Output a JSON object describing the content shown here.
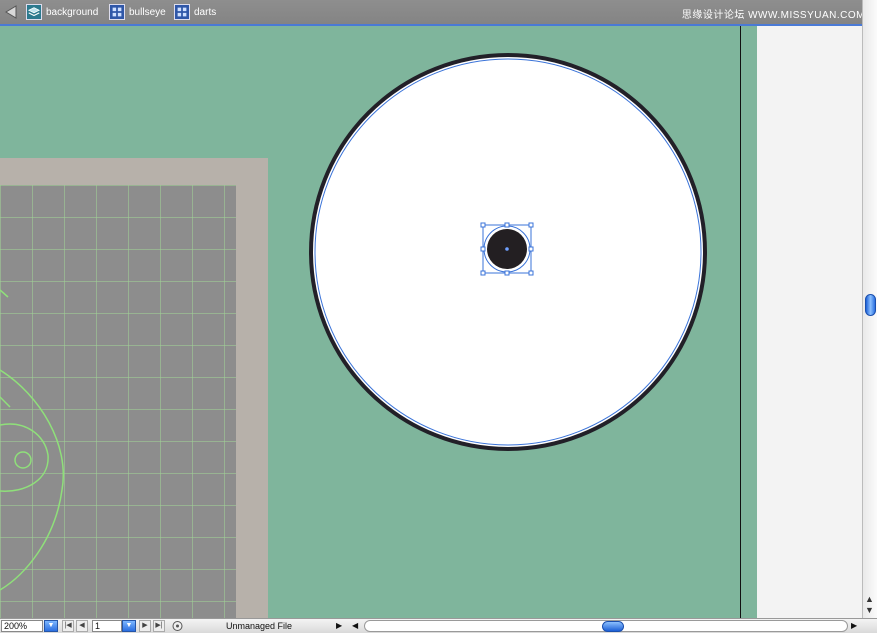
{
  "breadcrumbs": [
    {
      "label": "background",
      "icon": "layer-stack-icon"
    },
    {
      "label": "bullseye",
      "icon": "symbol-icon"
    },
    {
      "label": "darts",
      "icon": "symbol-icon"
    }
  ],
  "watermark": "思缘设计论坛 WWW.MISSYUAN.COM",
  "status": {
    "zoom": "200%",
    "page": "1",
    "file_status": "Unmanaged File"
  },
  "colors": {
    "stage": "#7fb59c",
    "selection": "#3a73d8",
    "grid_line": "#a0d296",
    "artwork_outline": "#8fe07a"
  }
}
